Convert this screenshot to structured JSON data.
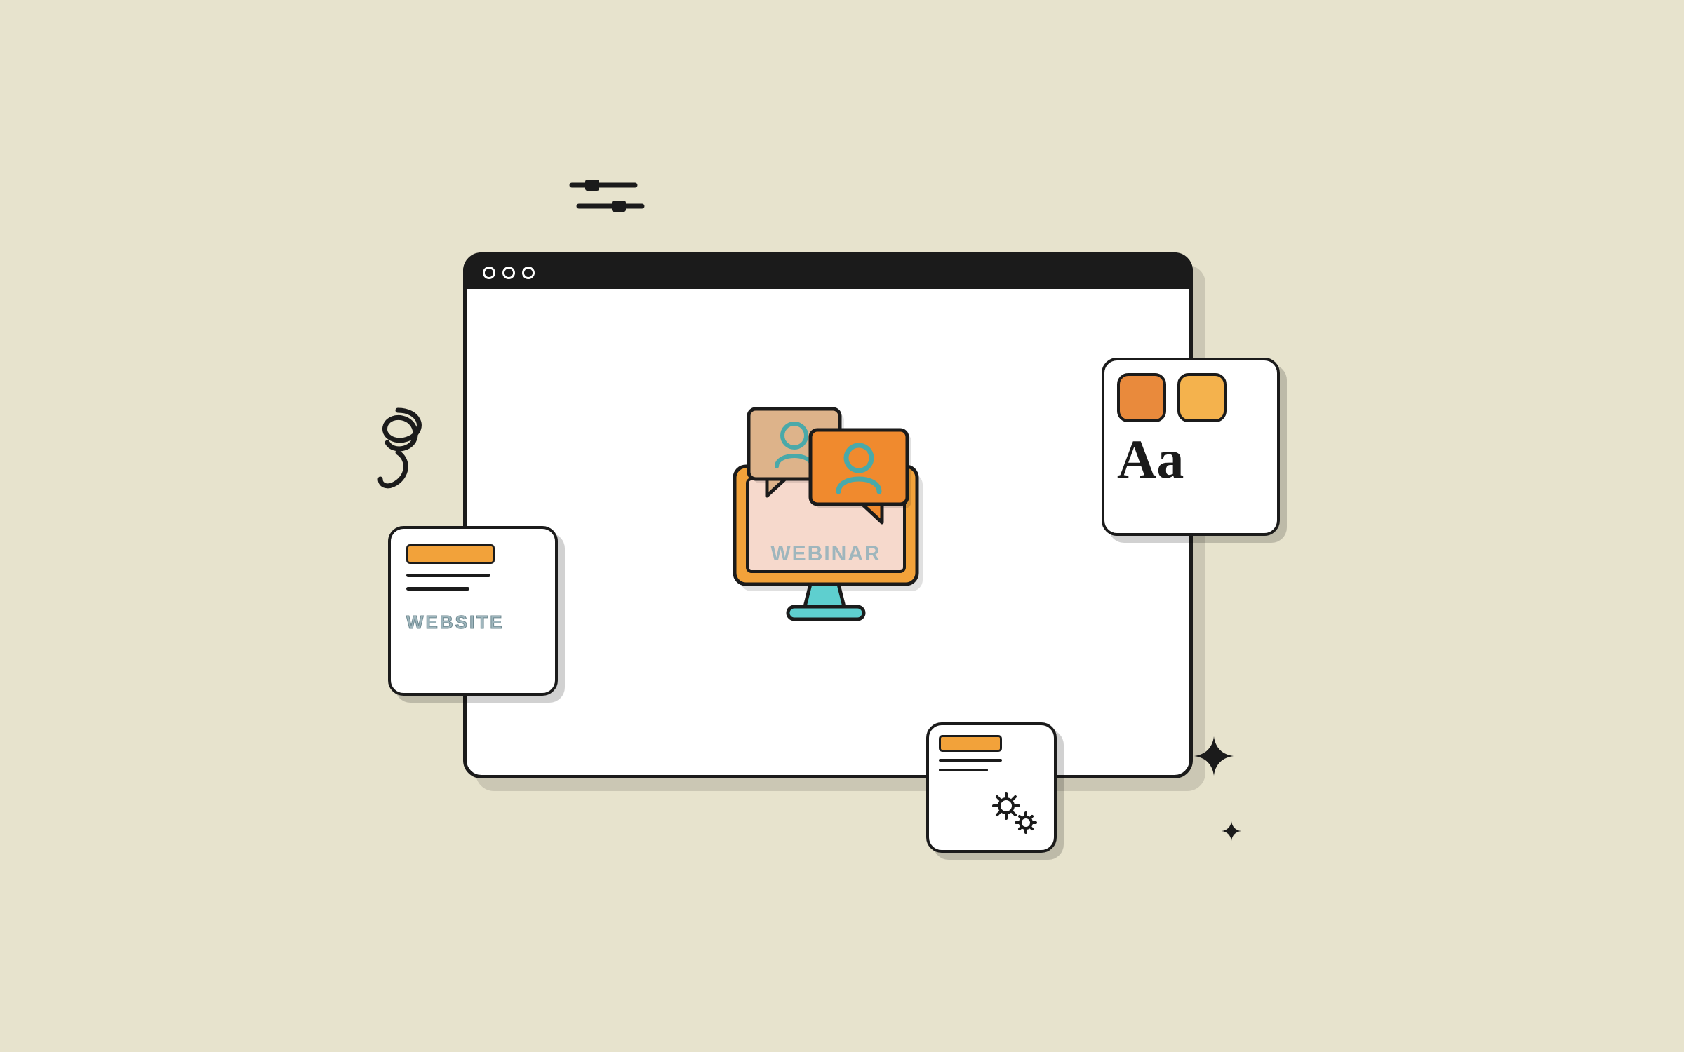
{
  "colors": {
    "background": "#e7e3cd",
    "stroke": "#1b1b1b",
    "orange": "#f2a23a",
    "orange_dark": "#e98a3c",
    "orange_light": "#f4b24d",
    "teal": "#5ecfcf",
    "pink": "#f6d9cc",
    "tan": "#ddb38a",
    "bubble_orange": "#f08a2e"
  },
  "browser": {
    "dot_count": 3
  },
  "center": {
    "screen_label": "WEBINAR"
  },
  "cards": {
    "website": {
      "label": "WEBSITE"
    },
    "styles": {
      "typography_sample": "Aa",
      "swatches": [
        "#e98a3c",
        "#f4b24d"
      ]
    },
    "settings": {
      "icon": "gears"
    }
  },
  "decorations": {
    "sliders_icon": "sliders-icon",
    "squiggle_icon": "squiggle-icon",
    "sparkle_icon": "sparkle-icon"
  }
}
